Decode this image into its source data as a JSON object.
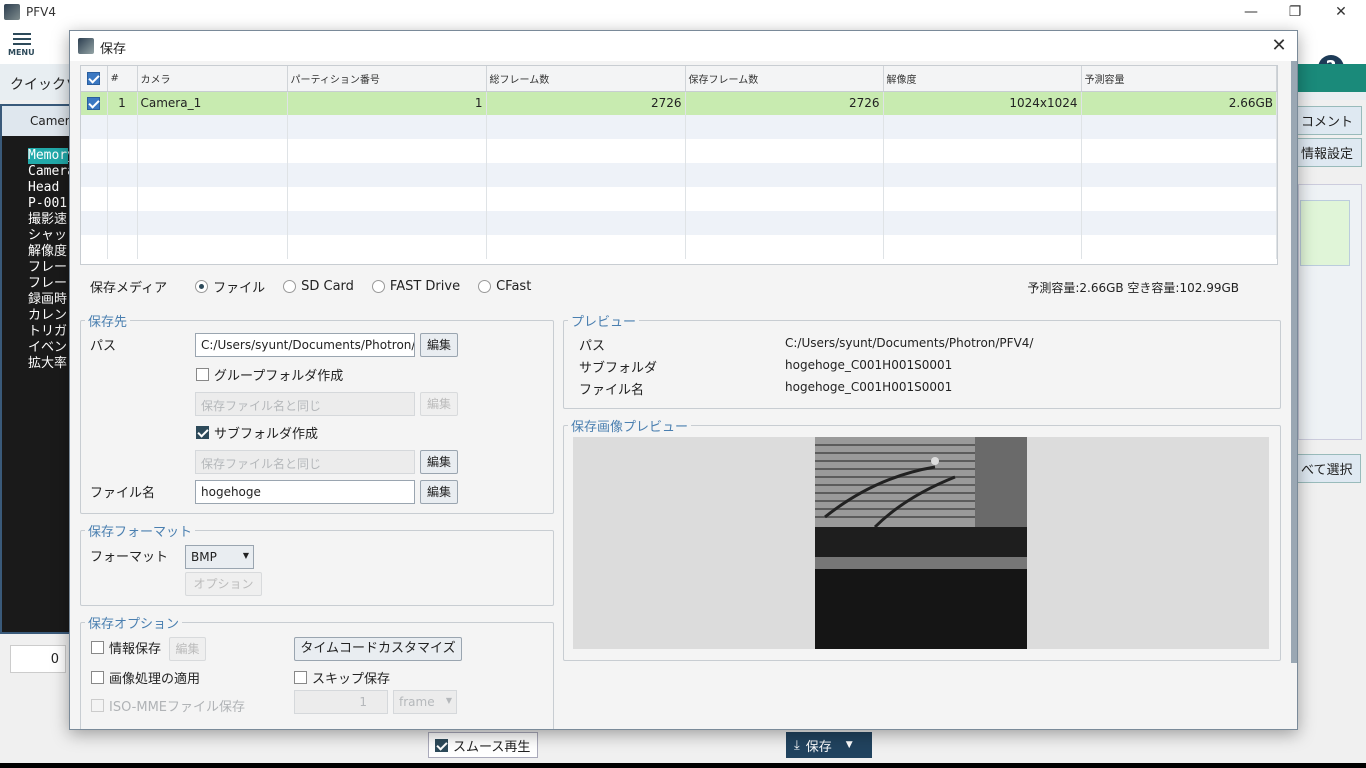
{
  "app": {
    "title": "PFV4",
    "menu_label": "MENU",
    "quick_label": "クイックツ",
    "help": "?",
    "win_min": "—",
    "win_max": "❐",
    "win_close": "✕",
    "camera_title": "Camera",
    "camera_lines": [
      "Memory",
      "Camera",
      "Head",
      "P-001",
      "撮影速",
      "シャッ",
      "解像度",
      "フレー",
      "フレー",
      "録画時",
      "カレン",
      "トリガ",
      "イベン",
      "拡大率"
    ],
    "right_buttons": [
      "コメント",
      "情報設定",
      "べて選択"
    ],
    "counter": "0",
    "smooth_label": "スムース再生",
    "save_label": "保存"
  },
  "dialog": {
    "title": "保存",
    "close": "✕",
    "table": {
      "headers": [
        "#",
        "カメラ",
        "パーティション番号",
        "総フレーム数",
        "保存フレーム数",
        "解像度",
        "予測容量"
      ],
      "rows": [
        {
          "index": "1",
          "camera": "Camera_1",
          "partition": "1",
          "total_frames": "2726",
          "save_frames": "2726",
          "resolution": "1024x1024",
          "estimate": "2.66GB",
          "checked": true
        }
      ]
    },
    "media": {
      "label": "保存メディア",
      "options": [
        "ファイル",
        "SD Card",
        "FAST Drive",
        "CFast"
      ],
      "selected": "ファイル",
      "capacity": "予測容量:2.66GB 空き容量:102.99GB"
    },
    "destination": {
      "legend": "保存先",
      "path_label": "パス",
      "path_value": "C:/Users/syunt/Documents/Photron/",
      "edit": "編集",
      "group_folder": "グループフォルダ作成",
      "group_placeholder": "保存ファイル名と同じ",
      "subfolder": "サブフォルダ作成",
      "subfolder_placeholder": "保存ファイル名と同じ",
      "filename_label": "ファイル名",
      "filename_value": "hogehoge"
    },
    "format": {
      "legend": "保存フォーマット",
      "label": "フォーマット",
      "value": "BMP",
      "option_button": "オプション"
    },
    "options": {
      "legend": "保存オプション",
      "info_save": "情報保存",
      "edit": "編集",
      "timecode": "タイムコードカスタマイズ",
      "image_processing": "画像処理の適用",
      "skip_save": "スキップ保存",
      "iso_mme": "ISO-MMEファイル保存",
      "skip_value": "1",
      "skip_unit": "frame"
    },
    "preview": {
      "legend": "プレビュー",
      "path_label": "パス",
      "path_value": "C:/Users/syunt/Documents/Photron/PFV4/",
      "subfolder_label": "サブフォルダ",
      "subfolder_value": "hogehoge_C001H001S0001",
      "filename_label": "ファイル名",
      "filename_value": "hogehoge_C001H001S0001"
    },
    "image_preview": {
      "legend": "保存画像プレビュー"
    }
  }
}
